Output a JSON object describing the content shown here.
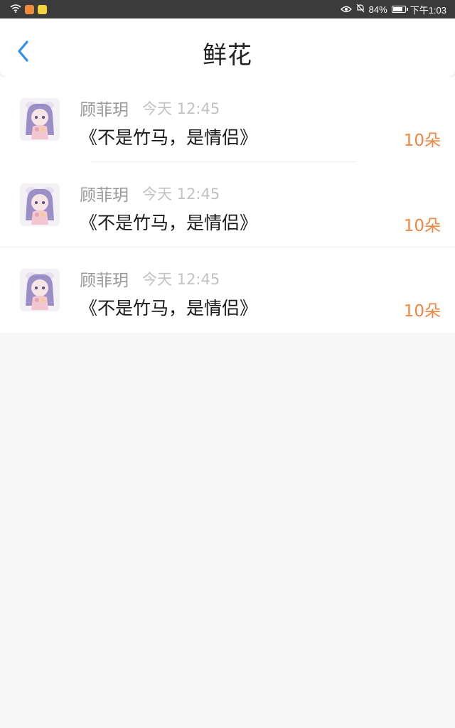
{
  "status_bar": {
    "battery": "84%",
    "battery_level": 0.84,
    "time": "下午1:03",
    "icons": [
      "wifi-icon",
      "app-notification-icon",
      "app-notification-icon",
      "eye-icon",
      "mute-bell-icon",
      "battery-icon"
    ]
  },
  "header": {
    "title": "鲜花",
    "back_icon": "chevron-left-icon",
    "accent_color": "#2b8ff0"
  },
  "items": [
    {
      "sender": "顾菲玥",
      "time": "今天 12:45",
      "gift": "《不是竹马，是情侣》",
      "count": "10朵"
    },
    {
      "sender": "顾菲玥",
      "time": "今天 12:45",
      "gift": "《不是竹马，是情侣》",
      "count": "10朵"
    },
    {
      "sender": "顾菲玥",
      "time": "今天 12:45",
      "gift": "《不是竹马，是情侣》",
      "count": "10朵"
    }
  ],
  "colors": {
    "count": "#ef8541",
    "sender": "#999999",
    "time": "#c2c2c2",
    "background": "#f8f7f8"
  }
}
